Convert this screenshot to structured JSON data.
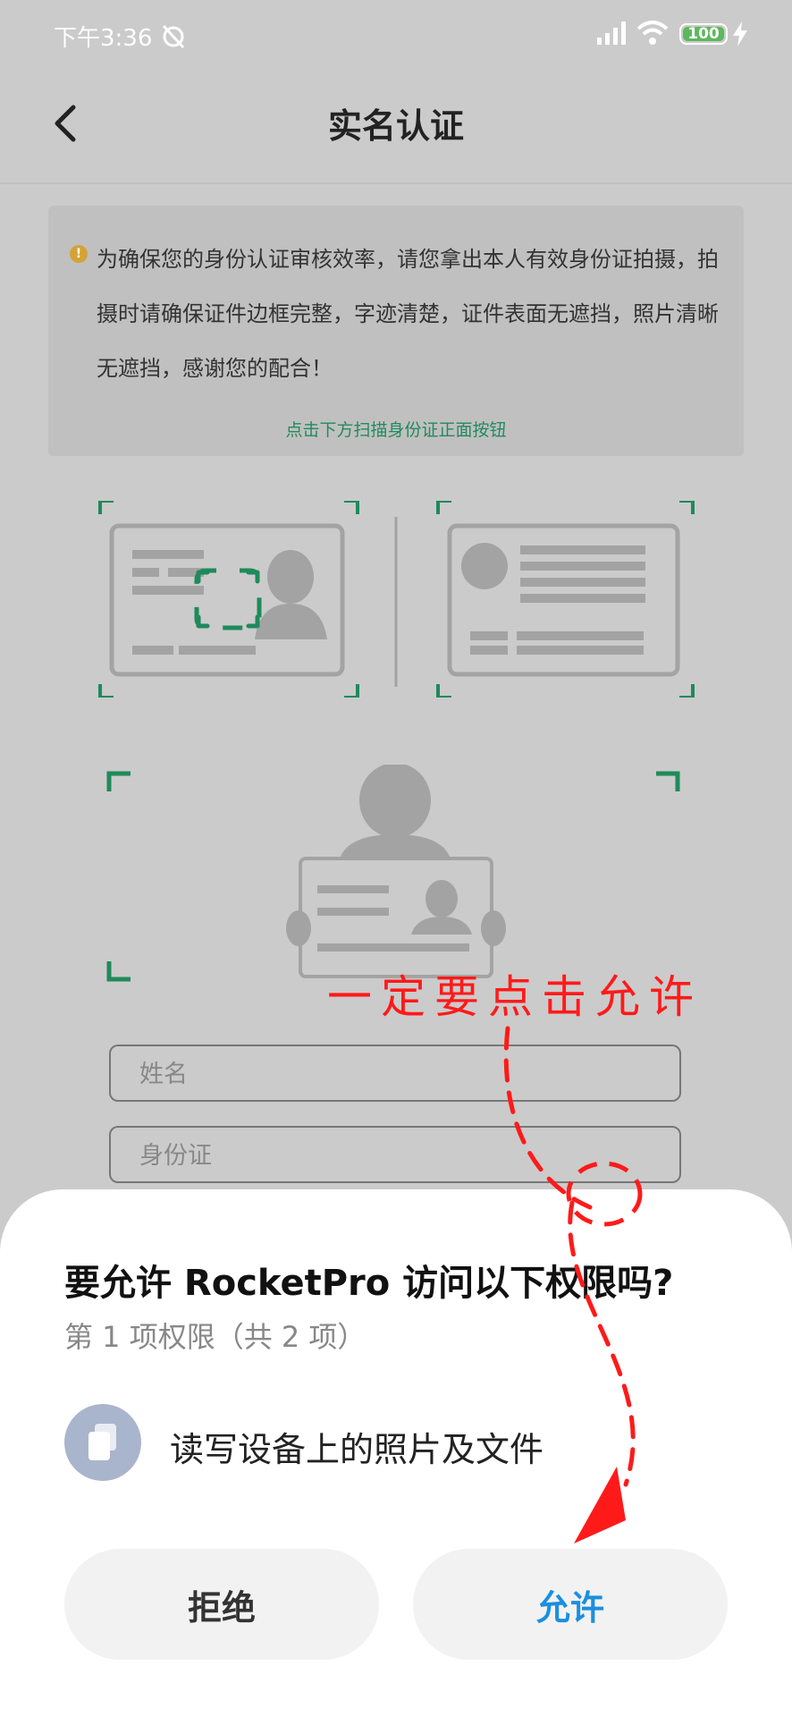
{
  "status_bar": {
    "time": "下午3:36",
    "battery": "100"
  },
  "header": {
    "title": "实名认证"
  },
  "notice": {
    "text": "为确保您的身份认证审核效率，请您拿出本人有效身份证拍摄，拍摄时请确保证件边框完整，字迹清楚，证件表面无遮挡，照片清晰无遮挡，感谢您的配合！",
    "link": "点击下方扫描身份证正面按钮"
  },
  "form": {
    "name_placeholder": "姓名",
    "id_placeholder": "身份证"
  },
  "annotation": {
    "text": "一定要点击允许"
  },
  "dialog": {
    "title": "要允许 RocketPro 访问以下权限吗?",
    "subtitle": "第 1 项权限（共 2 项）",
    "permission": "读写设备上的照片及文件",
    "deny_label": "拒绝",
    "allow_label": "允许"
  },
  "colors": {
    "accent_green": "#1f8a5b",
    "allow_blue": "#1b8fdf",
    "annotation_red": "#ff1a1a"
  }
}
